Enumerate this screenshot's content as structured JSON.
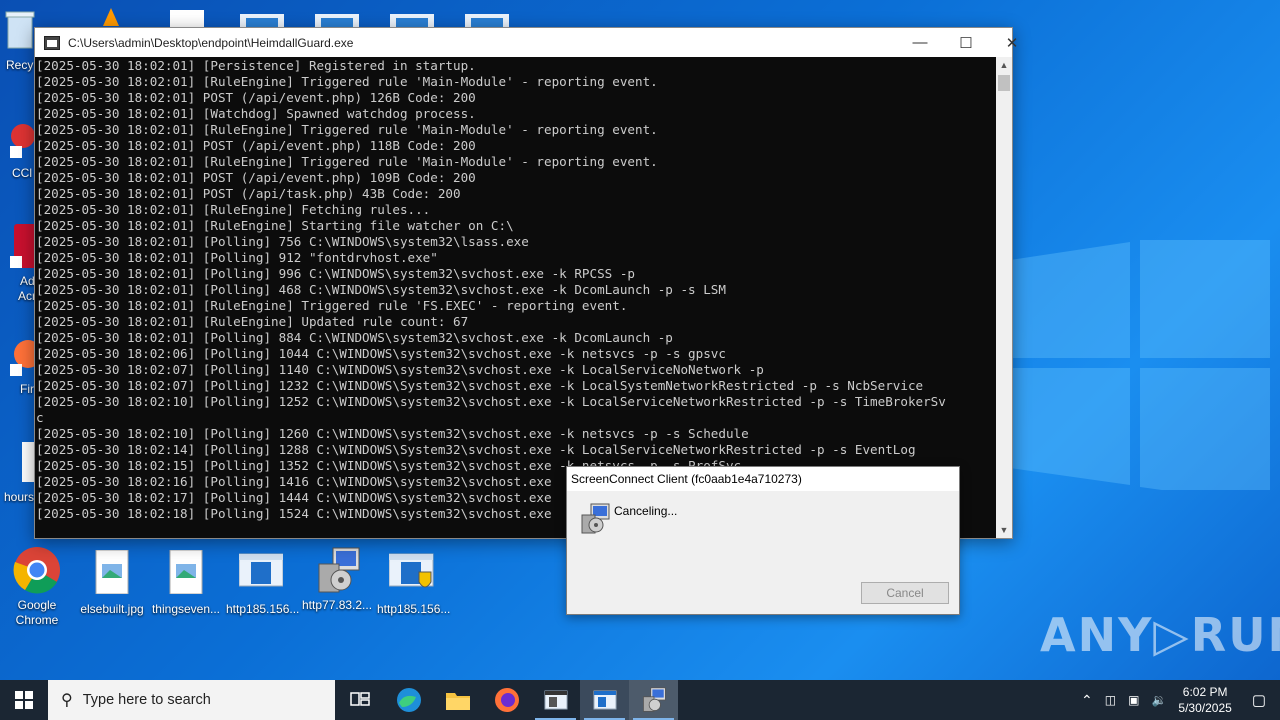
{
  "desktop": {
    "partial_labels": [
      "Recy",
      "CCl",
      "Ad",
      "Acr",
      "Fir",
      "hours"
    ],
    "icons": [
      {
        "label": "Google\nChrome",
        "icon": "chrome-icon"
      },
      {
        "label": "elsebuilt.jpg",
        "icon": "image-file-icon"
      },
      {
        "label": "thingseven...",
        "icon": "image-file-icon"
      },
      {
        "label": "http185.156...",
        "icon": "window-file-icon"
      },
      {
        "label": "http77.83.2...",
        "icon": "installer-icon"
      },
      {
        "label": "http185.156...",
        "icon": "shield-file-icon"
      }
    ]
  },
  "console": {
    "title": "C:\\Users\\admin\\Desktop\\endpoint\\HeimdallGuard.exe",
    "lines": [
      "[2025-05-30 18:02:01] [Persistence] Registered in startup.",
      "[2025-05-30 18:02:01] [RuleEngine] Triggered rule 'Main-Module' - reporting event.",
      "[2025-05-30 18:02:01] POST (/api/event.php) 126B Code: 200",
      "[2025-05-30 18:02:01] [Watchdog] Spawned watchdog process.",
      "[2025-05-30 18:02:01] [RuleEngine] Triggered rule 'Main-Module' - reporting event.",
      "[2025-05-30 18:02:01] POST (/api/event.php) 118B Code: 200",
      "[2025-05-30 18:02:01] [RuleEngine] Triggered rule 'Main-Module' - reporting event.",
      "[2025-05-30 18:02:01] POST (/api/event.php) 109B Code: 200",
      "[2025-05-30 18:02:01] POST (/api/task.php) 43B Code: 200",
      "[2025-05-30 18:02:01] [RuleEngine] Fetching rules...",
      "[2025-05-30 18:02:01] [RuleEngine] Starting file watcher on C:\\",
      "[2025-05-30 18:02:01] [Polling] 756 C:\\WINDOWS\\system32\\lsass.exe",
      "[2025-05-30 18:02:01] [Polling] 912 \"fontdrvhost.exe\"",
      "[2025-05-30 18:02:01] [Polling] 996 C:\\WINDOWS\\system32\\svchost.exe -k RPCSS -p",
      "[2025-05-30 18:02:01] [Polling] 468 C:\\WINDOWS\\system32\\svchost.exe -k DcomLaunch -p -s LSM",
      "[2025-05-30 18:02:01] [RuleEngine] Triggered rule 'FS.EXEC' - reporting event.",
      "[2025-05-30 18:02:01] [RuleEngine] Updated rule count: 67",
      "[2025-05-30 18:02:01] [Polling] 884 C:\\WINDOWS\\system32\\svchost.exe -k DcomLaunch -p",
      "[2025-05-30 18:02:06] [Polling] 1044 C:\\WINDOWS\\system32\\svchost.exe -k netsvcs -p -s gpsvc",
      "[2025-05-30 18:02:07] [Polling] 1140 C:\\WINDOWS\\system32\\svchost.exe -k LocalServiceNoNetwork -p",
      "[2025-05-30 18:02:07] [Polling] 1232 C:\\WINDOWS\\System32\\svchost.exe -k LocalSystemNetworkRestricted -p -s NcbService",
      "[2025-05-30 18:02:10] [Polling] 1252 C:\\WINDOWS\\system32\\svchost.exe -k LocalServiceNetworkRestricted -p -s TimeBrokerSv",
      "c",
      "[2025-05-30 18:02:10] [Polling] 1260 C:\\WINDOWS\\system32\\svchost.exe -k netsvcs -p -s Schedule",
      "[2025-05-30 18:02:14] [Polling] 1288 C:\\WINDOWS\\System32\\svchost.exe -k LocalServiceNetworkRestricted -p -s EventLog",
      "[2025-05-30 18:02:15] [Polling] 1352 C:\\WINDOWS\\system32\\svchost.exe -k netsvcs -p -s ProfSvc",
      "[2025-05-30 18:02:16] [Polling] 1416 C:\\WINDOWS\\system32\\svchost.exe",
      "[2025-05-30 18:02:17] [Polling] 1444 C:\\WINDOWS\\system32\\svchost.exe",
      "[2025-05-30 18:02:18] [Polling] 1524 C:\\WINDOWS\\system32\\svchost.exe"
    ]
  },
  "dialog": {
    "title": "ScreenConnect Client (fc0aab1e4a710273)",
    "message": "Canceling...",
    "cancel_label": "Cancel"
  },
  "watermark": "ANY▷RUN",
  "taskbar": {
    "search_placeholder": "Type here to search",
    "time": "6:02 PM",
    "date": "5/30/2025"
  }
}
